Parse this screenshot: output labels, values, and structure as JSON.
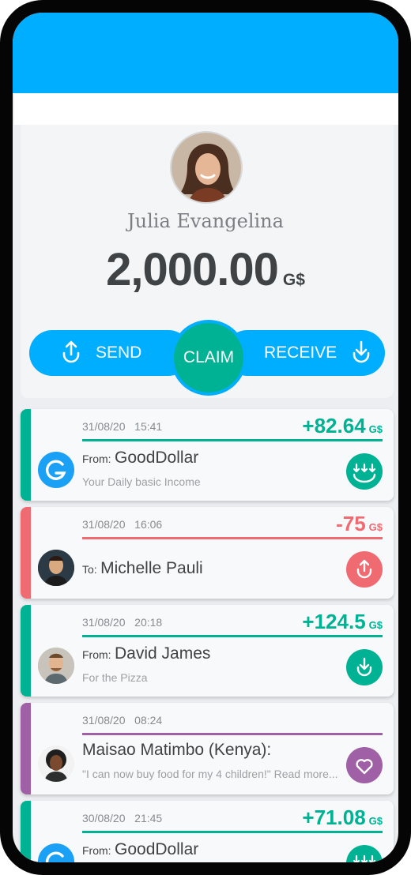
{
  "profile": {
    "name": "Julia Evangelina",
    "balance": "2,000.00",
    "currency": "G$"
  },
  "actions": {
    "send_label": "SEND",
    "claim_label": "CLAIM",
    "receive_label": "RECEIVE"
  },
  "feed": [
    {
      "date": "31/08/20",
      "time": "15:41",
      "amount": "+82.64",
      "currency": "G$",
      "prefix": "From:",
      "name": "GoodDollar",
      "subtitle": "Your Daily basic Income",
      "accent": "#00b294",
      "icon": "claim-icon"
    },
    {
      "date": "31/08/20",
      "time": "16:06",
      "amount": "-75",
      "currency": "G$",
      "prefix": "To:",
      "name": "Michelle Pauli",
      "subtitle": "",
      "accent": "#f06a72",
      "icon": "send-icon"
    },
    {
      "date": "31/08/20",
      "time": "20:18",
      "amount": "+124.5",
      "currency": "G$",
      "prefix": "From:",
      "name": "David James",
      "subtitle": "For the Pizza",
      "accent": "#00b294",
      "icon": "receive-icon"
    },
    {
      "date": "31/08/20",
      "time": "08:24",
      "amount": "",
      "currency": "",
      "prefix": "",
      "name": "Maisao Matimbo (Kenya):",
      "subtitle": "\"I can now buy food for my 4 children!\" Read more...",
      "accent": "#9f60a6",
      "icon": "heart-icon"
    },
    {
      "date": "30/08/20",
      "time": "21:45",
      "amount": "+71.08",
      "currency": "G$",
      "prefix": "From:",
      "name": "GoodDollar",
      "subtitle": "",
      "accent": "#00b294",
      "icon": "claim-icon"
    }
  ]
}
